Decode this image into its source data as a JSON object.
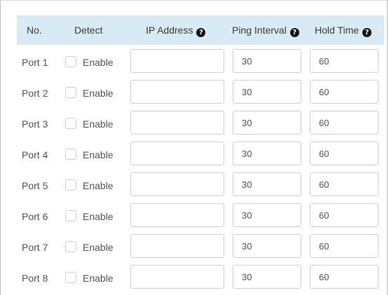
{
  "header": {
    "no": "No.",
    "detect": "Detect",
    "ip_address": "IP Address",
    "ping_interval": "Ping Interval",
    "hold_time": "Hold Time"
  },
  "icons": {
    "help": "question-circle-icon"
  },
  "colors": {
    "header_background": "#d8eaf4",
    "border": "#cfcfcf",
    "text": "#555555"
  },
  "rows": [
    {
      "port": "Port 1",
      "detect_label": "Enable",
      "detect_checked": false,
      "ip_address": "",
      "ping_interval": "30",
      "hold_time": "60"
    },
    {
      "port": "Port 2",
      "detect_label": "Enable",
      "detect_checked": false,
      "ip_address": "",
      "ping_interval": "30",
      "hold_time": "60"
    },
    {
      "port": "Port 3",
      "detect_label": "Enable",
      "detect_checked": false,
      "ip_address": "",
      "ping_interval": "30",
      "hold_time": "60"
    },
    {
      "port": "Port 4",
      "detect_label": "Enable",
      "detect_checked": false,
      "ip_address": "",
      "ping_interval": "30",
      "hold_time": "60"
    },
    {
      "port": "Port 5",
      "detect_label": "Enable",
      "detect_checked": false,
      "ip_address": "",
      "ping_interval": "30",
      "hold_time": "60"
    },
    {
      "port": "Port 6",
      "detect_label": "Enable",
      "detect_checked": false,
      "ip_address": "",
      "ping_interval": "30",
      "hold_time": "60"
    },
    {
      "port": "Port 7",
      "detect_label": "Enable",
      "detect_checked": false,
      "ip_address": "",
      "ping_interval": "30",
      "hold_time": "60"
    },
    {
      "port": "Port 8",
      "detect_label": "Enable",
      "detect_checked": false,
      "ip_address": "",
      "ping_interval": "30",
      "hold_time": "60"
    }
  ]
}
